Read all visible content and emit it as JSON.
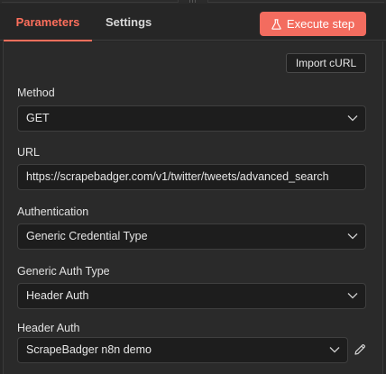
{
  "tabs": [
    {
      "label": "Parameters",
      "active": true
    },
    {
      "label": "Settings",
      "active": false
    }
  ],
  "execute_button": {
    "label": "Execute step",
    "icon": "flask-icon",
    "color": "#f36c5f"
  },
  "import_curl": {
    "label": "Import cURL"
  },
  "fields": {
    "method": {
      "label": "Method",
      "value": "GET"
    },
    "url": {
      "label": "URL",
      "value": "https://scrapebadger.com/v1/twitter/tweets/advanced_search"
    },
    "authentication": {
      "label": "Authentication",
      "value": "Generic Credential Type"
    },
    "generic_auth_type": {
      "label": "Generic Auth Type",
      "value": "Header Auth"
    },
    "header_auth": {
      "label": "Header Auth",
      "value": "ScrapeBadger n8n demo"
    }
  },
  "accent_color": "#ff6f5c"
}
